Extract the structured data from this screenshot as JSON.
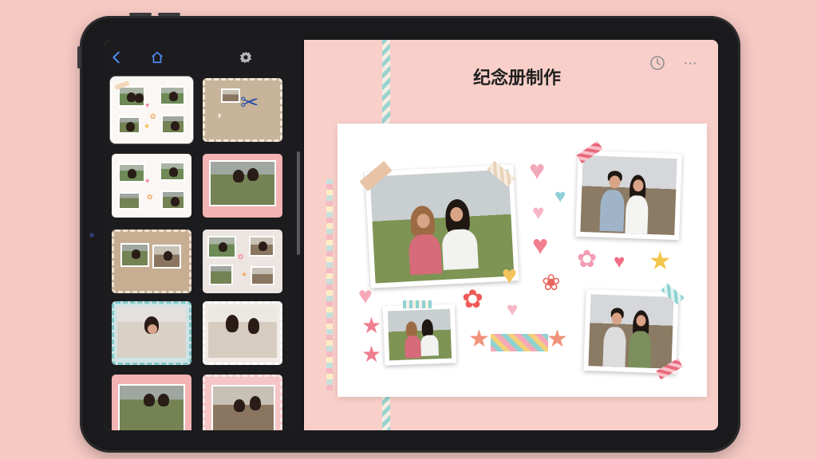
{
  "app": {
    "title": "纪念册制作"
  },
  "toolbar": {
    "back_icon": "chevron-left-icon",
    "home_icon": "home-icon",
    "settings_icon": "gear-icon"
  },
  "header_actions": {
    "history_icon": "clock-icon",
    "more_label": "···"
  },
  "colors": {
    "accent": "#4f8ef7",
    "background": "#f6c9c3",
    "sidebar": "#1c1c1e"
  },
  "templates": [
    {
      "name": "template-1",
      "selected": true
    },
    {
      "name": "template-2",
      "selected": false
    },
    {
      "name": "template-3",
      "selected": false
    },
    {
      "name": "template-4",
      "selected": false
    },
    {
      "name": "template-5",
      "selected": false
    },
    {
      "name": "template-6",
      "selected": false
    },
    {
      "name": "template-7",
      "selected": false
    },
    {
      "name": "template-8",
      "selected": false
    },
    {
      "name": "template-9",
      "selected": false
    },
    {
      "name": "template-10",
      "selected": false
    }
  ]
}
